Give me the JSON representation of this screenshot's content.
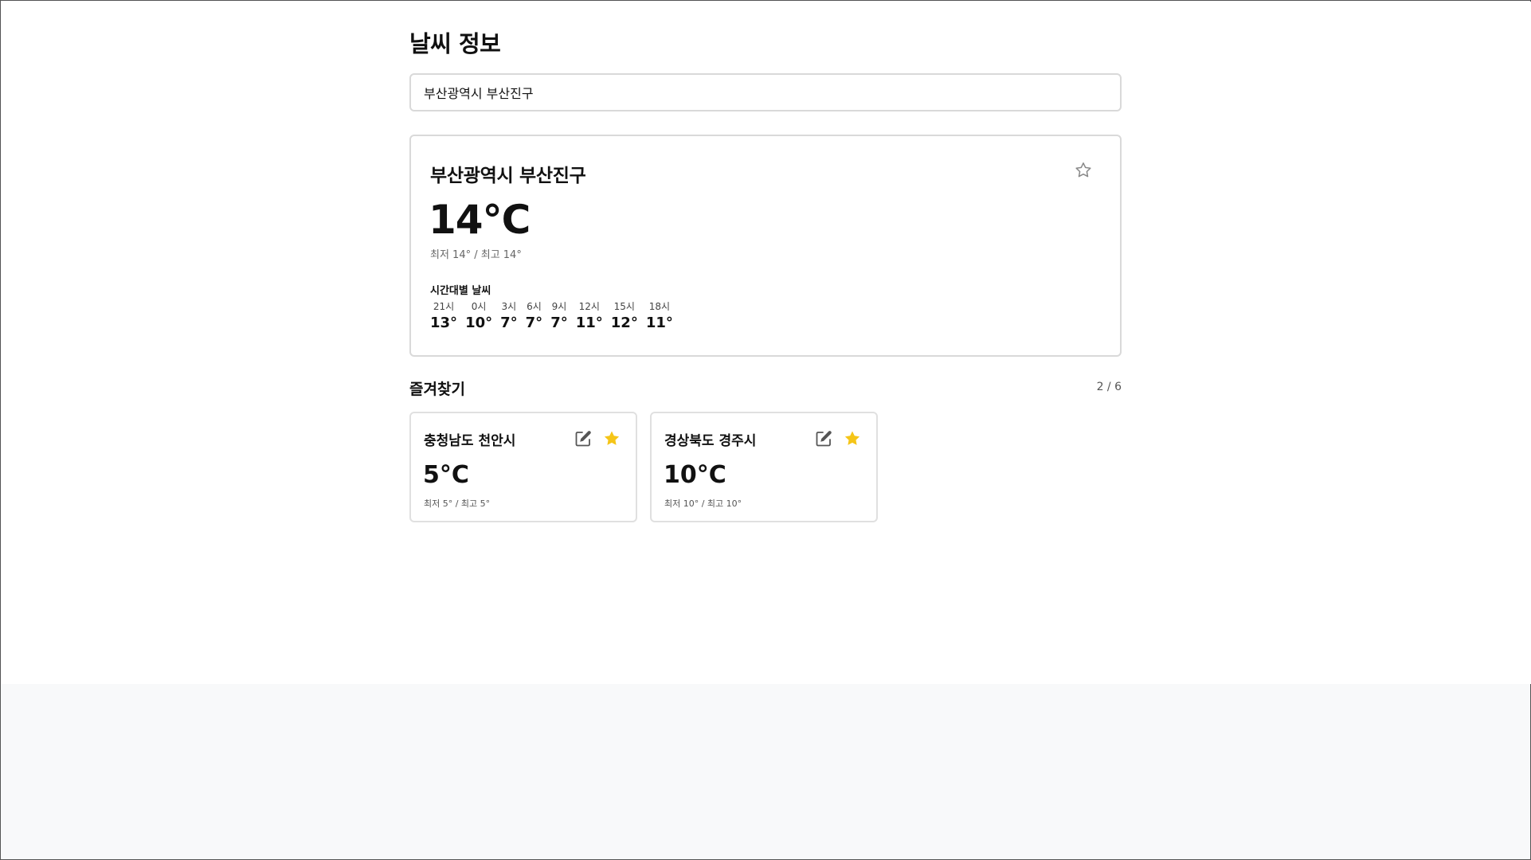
{
  "header": {
    "title": "날씨 정보"
  },
  "search": {
    "value": "부산광역시 부산진구"
  },
  "current": {
    "location": "부산광역시 부산진구",
    "temperature": "14°C",
    "range": "최저 14° / 최고 14°",
    "favorite_icon": "star-outline-icon",
    "hourly_title": "시간대별 날씨",
    "hourly": [
      {
        "time": "21시",
        "temp": "13°"
      },
      {
        "time": "0시",
        "temp": "10°"
      },
      {
        "time": "3시",
        "temp": "7°"
      },
      {
        "time": "6시",
        "temp": "7°"
      },
      {
        "time": "9시",
        "temp": "7°"
      },
      {
        "time": "12시",
        "temp": "11°"
      },
      {
        "time": "15시",
        "temp": "12°"
      },
      {
        "time": "18시",
        "temp": "11°"
      }
    ]
  },
  "favorites": {
    "title": "즐겨찾기",
    "count": "2 / 6",
    "star_color": "#f5c518",
    "items": [
      {
        "name": "충청남도 천안시",
        "temperature": "5°C",
        "range": "최저 5° / 최고 5°"
      },
      {
        "name": "경상북도 경주시",
        "temperature": "10°C",
        "range": "최저 10° / 최고 10°"
      }
    ]
  }
}
